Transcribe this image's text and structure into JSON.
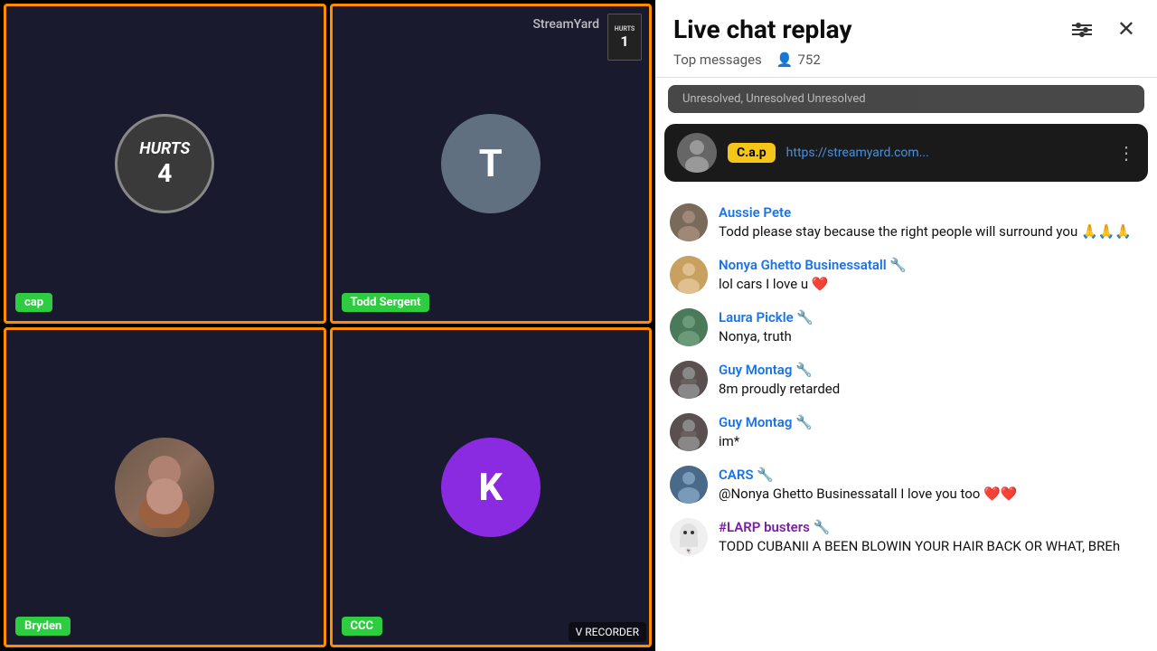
{
  "video_panel": {
    "cells": [
      {
        "id": "cap",
        "label": "cap",
        "type": "hurts_avatar",
        "hurts_text": "HURTS",
        "hurts_num": "4"
      },
      {
        "id": "todd",
        "label": "Todd Sergent",
        "type": "letter_avatar",
        "letter": "T",
        "avatar_color": "gray",
        "watermark": "StreamYard",
        "jersey": true
      },
      {
        "id": "bryden",
        "label": "Bryden",
        "type": "person_photo"
      },
      {
        "id": "ccc",
        "label": "CCC",
        "type": "letter_avatar",
        "letter": "K",
        "avatar_color": "purple"
      }
    ]
  },
  "chat": {
    "title": "Live chat replay",
    "subtitle": "Top messages",
    "viewer_count": "752",
    "pinned_text": "Unresolved, Unresolved Unresolved",
    "cap_banner": {
      "badge": "C.a.p",
      "link": "https://streamyard.com..."
    },
    "messages": [
      {
        "id": "aussie",
        "username": "Aussie Pete",
        "username_color": "blue",
        "wrench": false,
        "text": "Todd please stay because the right people will surround you 🙏🙏🙏",
        "avatar_color": "#7a6a5a"
      },
      {
        "id": "nonya",
        "username": "Nonya Ghetto Businessatall 🔧",
        "username_color": "blue",
        "wrench": false,
        "text": "lol cars I love u ❤️",
        "avatar_color": "#c8a060"
      },
      {
        "id": "laura",
        "username": "Laura Pickle 🔧",
        "username_color": "blue",
        "wrench": false,
        "text": "Nonya, truth",
        "avatar_color": "#4a7a5a"
      },
      {
        "id": "guy1",
        "username": "Guy Montag 🔧",
        "username_color": "blue",
        "wrench": false,
        "text": "8m proudly retarded",
        "avatar_color": "#5a5050"
      },
      {
        "id": "guy2",
        "username": "Guy Montag 🔧",
        "username_color": "blue",
        "wrench": false,
        "text": "im*",
        "avatar_color": "#5a5050"
      },
      {
        "id": "cars",
        "username": "CARS 🔧",
        "username_color": "blue",
        "wrench": false,
        "text": "@Nonya Ghetto Businessatall I love you too ❤️❤️",
        "avatar_color": "#4a6a8a"
      },
      {
        "id": "larp",
        "username": "#LARP busters 🔧",
        "username_color": "purple",
        "wrench": false,
        "text": "TODD CUBANII A BEEN BLOWIN YOUR HAIR BACK OR WHAT, BREh",
        "avatar_color": "#f0f0f0"
      }
    ]
  },
  "icons": {
    "close": "✕",
    "sliders": "⚙",
    "viewers": "👤",
    "three_dots": "⋮"
  },
  "watermark": "V RECORDER"
}
